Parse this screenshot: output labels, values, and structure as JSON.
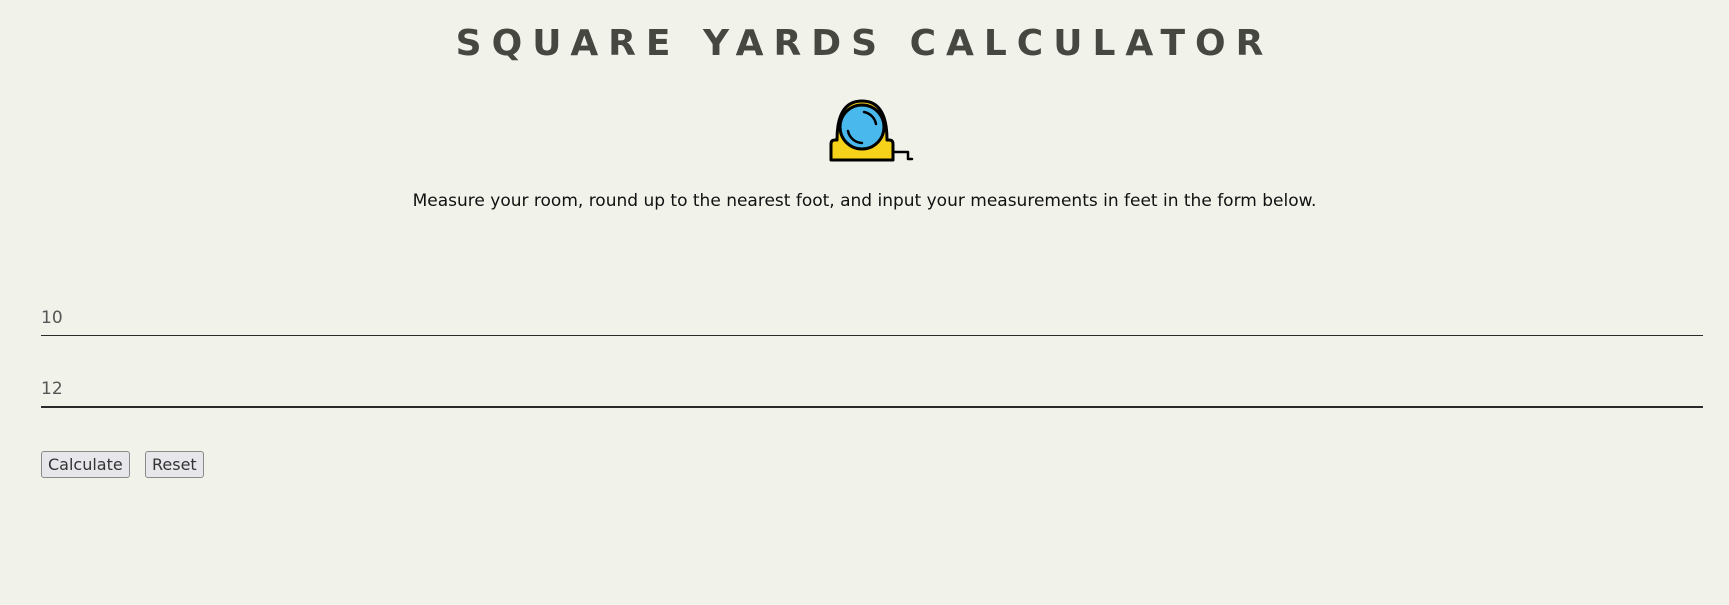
{
  "header": {
    "title": "SQUARE YARDS CALCULATOR"
  },
  "icon": {
    "name": "tape-measure-icon",
    "colors": {
      "body": "#f7d21a",
      "lens": "#49b8ec",
      "outline": "#000000"
    }
  },
  "description": "Measure your room, round up to the nearest foot, and input your measurements in feet in the form below.",
  "form": {
    "length_value": "10",
    "width_value": "12",
    "calculate_label": "Calculate",
    "reset_label": "Reset"
  },
  "colors": {
    "background": "#f1f2ea",
    "title": "#474742"
  }
}
